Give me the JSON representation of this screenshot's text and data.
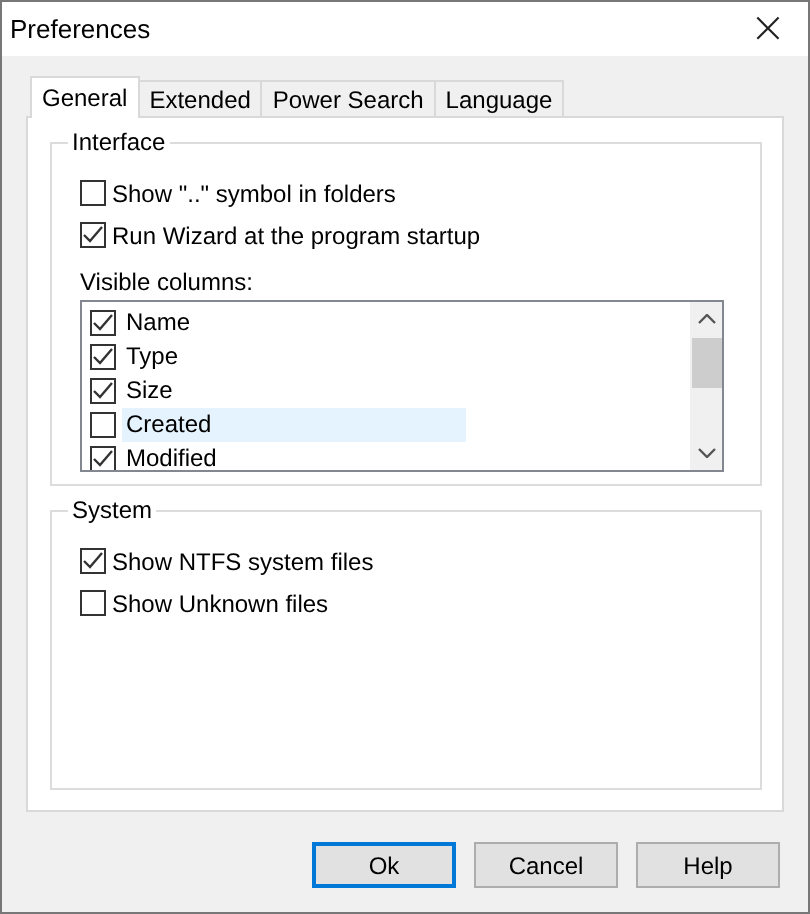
{
  "window": {
    "title": "Preferences",
    "close": "×"
  },
  "tabs": [
    {
      "label": "General",
      "selected": true
    },
    {
      "label": "Extended",
      "selected": false
    },
    {
      "label": "Power Search",
      "selected": false
    },
    {
      "label": "Language",
      "selected": false
    }
  ],
  "interface": {
    "title": "Interface",
    "options": [
      {
        "label": "Show \"..\" symbol in folders",
        "checked": false
      },
      {
        "label": "Run Wizard at the program startup",
        "checked": true
      }
    ],
    "columns_label": "Visible columns:",
    "columns": [
      {
        "label": "Name",
        "checked": true,
        "selected": false
      },
      {
        "label": "Type",
        "checked": true,
        "selected": false
      },
      {
        "label": "Size",
        "checked": true,
        "selected": false
      },
      {
        "label": "Created",
        "checked": false,
        "selected": true
      },
      {
        "label": "Modified",
        "checked": true,
        "selected": false
      }
    ]
  },
  "system": {
    "title": "System",
    "options": [
      {
        "label": "Show NTFS system files",
        "checked": true
      },
      {
        "label": "Show Unknown files",
        "checked": false
      }
    ]
  },
  "buttons": [
    {
      "label": "Ok",
      "default": true
    },
    {
      "label": "Cancel",
      "default": false
    },
    {
      "label": "Help",
      "default": false
    }
  ]
}
